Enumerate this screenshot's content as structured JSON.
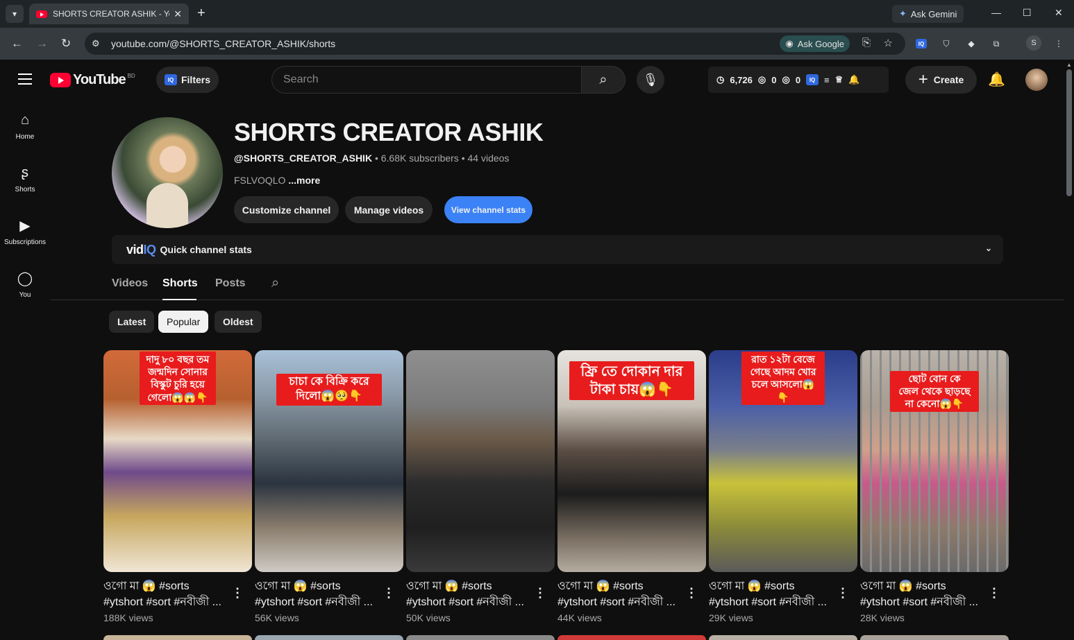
{
  "browser": {
    "tab_title": "SHORTS CREATOR ASHIK - YouTube",
    "ask_gemini": "Ask Gemini",
    "url": "youtube.com/@SHORTS_CREATOR_ASHIK/shorts",
    "ask_google": "Ask Google",
    "profile_initial": "S"
  },
  "header": {
    "logo_word": "YouTube",
    "country_code": "BD",
    "filters_label": "Filters",
    "search_placeholder": "Search",
    "stats": {
      "count1": "6,726",
      "count2": "0",
      "count3": "0"
    },
    "create_label": "Create"
  },
  "sidebar": {
    "items": [
      {
        "label": "Home",
        "icon": "home-icon"
      },
      {
        "label": "Shorts",
        "icon": "shorts-icon"
      },
      {
        "label": "Subscriptions",
        "icon": "subscriptions-icon"
      },
      {
        "label": "You",
        "icon": "you-icon"
      }
    ]
  },
  "channel": {
    "name": "SHORTS CREATOR ASHIK",
    "handle": "@SHORTS_CREATOR_ASHIK",
    "subscribers": "6.68K subscribers",
    "videos": "44 videos",
    "description": "FSLVOQLO",
    "more": "...more",
    "customize_label": "Customize channel",
    "manage_label": "Manage videos",
    "stats_label": "View channel stats"
  },
  "quick_stats": {
    "brand_a": "vid",
    "brand_b": "IQ",
    "label": "Quick channel stats"
  },
  "tabs": {
    "videos": "Videos",
    "shorts": "Shorts",
    "posts": "Posts"
  },
  "chips": {
    "latest": "Latest",
    "popular": "Popular",
    "oldest": "Oldest"
  },
  "shorts": [
    {
      "caption": "দাদু ৮০ বছর তম\nজন্মদিন সোনার\nবিস্কুট চুরি হয়ে\nগেলো😱😱👇",
      "title1": "ওগো মা 😱 #sorts",
      "title2": "#ytshort #sort #নবীজী ...",
      "views": "188K views"
    },
    {
      "caption": "চাচা কে বিক্রি করে\nদিলো😱🥺👇",
      "title1": "ওগো মা 😱 #sorts",
      "title2": "#ytshort #sort #নবীজী ...",
      "views": "56K views"
    },
    {
      "caption": "",
      "title1": "ওগো মা 😱 #sorts",
      "title2": "#ytshort #sort #নবীজী ...",
      "views": "50K views"
    },
    {
      "caption": "ফ্রি তে দোকান দার\nটাকা চায়😱👇",
      "title1": "ওগো মা 😱 #sorts",
      "title2": "#ytshort #sort #নবীজী ...",
      "views": "44K views"
    },
    {
      "caption": "রাত ১২টা বেজে\nগেছে আদম খোর\nচলে আসলো😱👇",
      "title1": "ওগো মা 😱 #sorts",
      "title2": "#ytshort #sort #নবীজী ...",
      "views": "29K views"
    },
    {
      "caption": "ছোট বোন কে\nজেল থেকে ছাড়ছে\nনা কেনো😱👇",
      "title1": "ওগো মা 😱 #sorts",
      "title2": "#ytshort #sort #নবীজী ...",
      "views": "28K views"
    }
  ]
}
